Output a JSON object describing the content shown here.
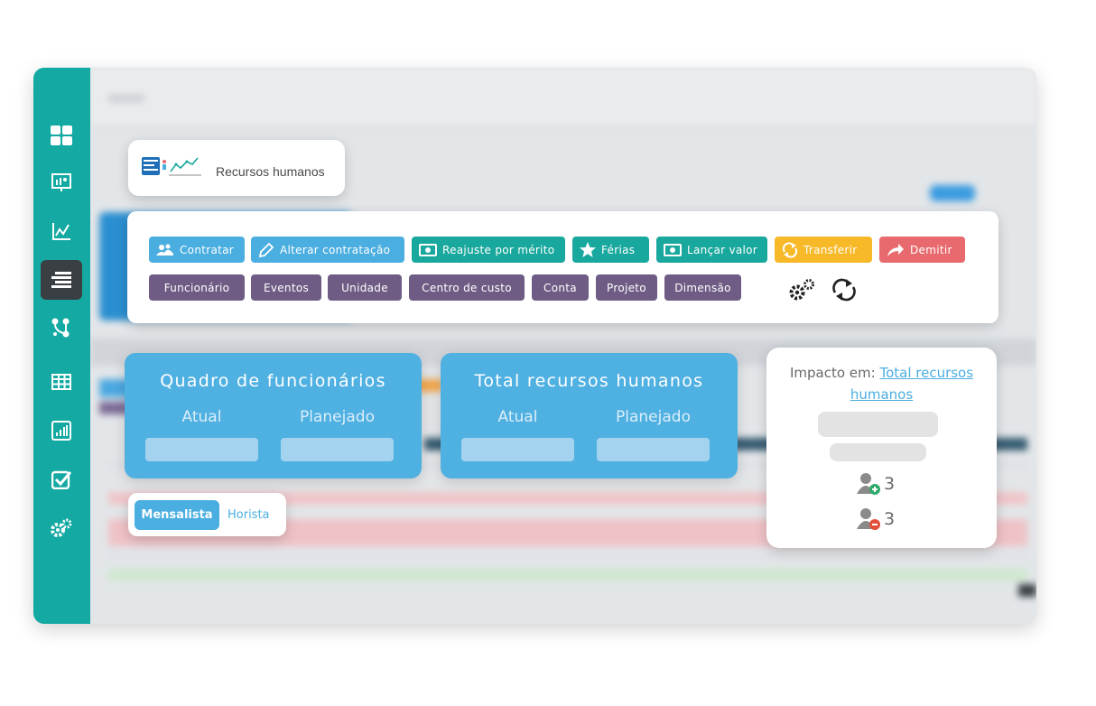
{
  "sidebar": {
    "items": [
      {
        "icon": "dashboard-icon"
      },
      {
        "icon": "presentation-icon"
      },
      {
        "icon": "line-chart-icon"
      },
      {
        "icon": "list-icon",
        "active": true
      },
      {
        "icon": "flow-icon"
      },
      {
        "icon": "table-icon"
      },
      {
        "icon": "bar-chart-icon"
      },
      {
        "icon": "checkbox-icon"
      },
      {
        "icon": "settings-icon"
      }
    ]
  },
  "header": {
    "title": "Recursos humanos"
  },
  "toolbar": {
    "actions": [
      {
        "label": "Contratar",
        "icon": "users-icon",
        "color": "#4aaee0"
      },
      {
        "label": "Alterar contratação",
        "icon": "pencil-icon",
        "color": "#4aaee0"
      },
      {
        "label": "Reajuste por mérito",
        "icon": "money-icon",
        "color": "#19a89d"
      },
      {
        "label": "Férias",
        "icon": "star-icon",
        "color": "#19a89d"
      },
      {
        "label": "Lançar valor",
        "icon": "money-icon",
        "color": "#19a89d"
      },
      {
        "label": "Transferir",
        "icon": "sync-icon",
        "color": "#f7b928"
      },
      {
        "label": "Demitir",
        "icon": "share-icon",
        "color": "#e86a6e"
      }
    ],
    "filters": [
      "Funcionário",
      "Eventos",
      "Unidade",
      "Centro de custo",
      "Conta",
      "Projeto",
      "Dimensão"
    ]
  },
  "metrics": [
    {
      "title": "Quadro de funcionários",
      "actual_label": "Atual",
      "planned_label": "Planejado"
    },
    {
      "title": "Total recursos humanos",
      "actual_label": "Atual",
      "planned_label": "Planejado"
    }
  ],
  "toggle": {
    "active": "Mensalista",
    "inactive": "Horista"
  },
  "impact": {
    "prefix": "Impacto em:",
    "link": "Total recursos humanos",
    "added_count": "3",
    "removed_count": "3"
  }
}
